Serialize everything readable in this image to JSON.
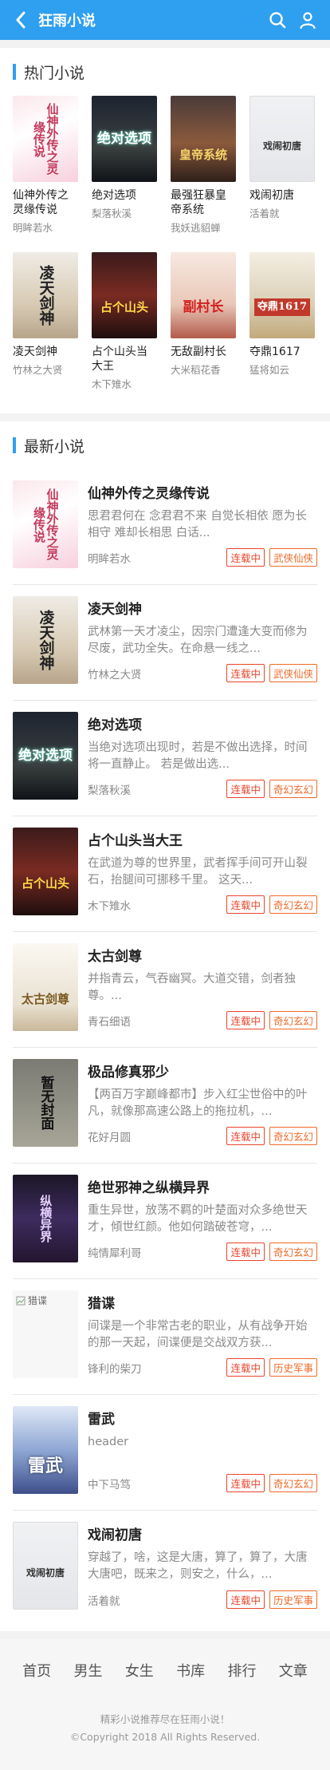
{
  "header": {
    "title": "狂雨小说",
    "back_icon": "back-arrow-icon",
    "search_icon": "search-icon",
    "user_icon": "user-icon"
  },
  "hot": {
    "title": "热门小说",
    "items": [
      {
        "title": "仙神外传之灵缘传说",
        "author": "明眸若水",
        "cover_text": "仙神外传之灵缘传说"
      },
      {
        "title": "绝对选项",
        "author": "梨落秋溪",
        "cover_text": "绝对选项"
      },
      {
        "title": "最强狂暴皇帝系统",
        "author": "我妖逃貂蝉",
        "cover_text": "皇帝系统"
      },
      {
        "title": "戏闹初唐",
        "author": "活着就",
        "cover_text": "戏闹初唐"
      },
      {
        "title": "凌天剑神",
        "author": "竹林之大贤",
        "cover_text": "凌天剑神"
      },
      {
        "title": "占个山头当大王",
        "author": "木下雉水",
        "cover_text": "占个山头"
      },
      {
        "title": "无敌副村长",
        "author": "大米稻花香",
        "cover_text": "副村长"
      },
      {
        "title": "夺鼎1617",
        "author": "猛将如云",
        "cover_text": "夺鼎1617"
      }
    ]
  },
  "latest": {
    "title": "最新小说",
    "items": [
      {
        "title": "仙神外传之灵缘传说",
        "desc": "思君君何在 念君君不来 自觉长相依 愿为长相守 难却长相思 白话...",
        "author": "明眸若水",
        "status": "连载中",
        "genre": "武侠仙侠",
        "cover_text": "仙神外传之灵缘传说"
      },
      {
        "title": "凌天剑神",
        "desc": "武林第一天才凌尘，因宗门遭逢大变而修为尽废，武功全失。在命悬一线之...",
        "author": "竹林之大贤",
        "status": "连载中",
        "genre": "武侠仙侠",
        "cover_text": "凌天剑神"
      },
      {
        "title": "绝对选项",
        "desc": "当绝对选项出现时，若是不做出选择，时间将一直静止。 若是做出选...",
        "author": "梨落秋溪",
        "status": "连载中",
        "genre": "奇幻玄幻",
        "cover_text": "绝对选项"
      },
      {
        "title": "占个山头当大王",
        "desc": "在武道为尊的世界里，武者挥手间可开山裂石，抬腿间可挪移千里。 这天...",
        "author": "木下雉水",
        "status": "连载中",
        "genre": "奇幻玄幻",
        "cover_text": "占个山头"
      },
      {
        "title": "太古剑尊",
        "desc": "并指青云，气吞幽冥。大道交错，剑者独尊。...",
        "author": "青石细语",
        "status": "连载中",
        "genre": "奇幻玄幻",
        "cover_text": "太古剑尊"
      },
      {
        "title": "极品修真邪少",
        "desc": "【两百万字巅峰都市】步入红尘世俗中的叶凡，就像那高速公路上的拖拉机，...",
        "author": "花好月圆",
        "status": "连载中",
        "genre": "奇幻玄幻",
        "cover_text": "暂无封面"
      },
      {
        "title": "绝世邪神之纵横异界",
        "desc": "重生异世，放荡不羁的叶楚面对众多绝世天才，傾世红颜。他如何踏破苍穹，...",
        "author": "纯情犀利哥",
        "status": "连载中",
        "genre": "奇幻玄幻",
        "cover_text": "纵横异界"
      },
      {
        "title": "猎谍",
        "desc": "间谍是一个非常古老的职业，从有战争开始的那一天起，间谍便是交战双方获...",
        "author": "锋利的柴刀",
        "status": "连载中",
        "genre": "历史军事",
        "cover_text": "猎谍"
      },
      {
        "title": "雷武",
        "desc": "header",
        "author": "中下马笃",
        "status": "连载中",
        "genre": "奇幻玄幻",
        "cover_text": "雷武"
      },
      {
        "title": "戏闹初唐",
        "desc": "穿越了，啥，这是大唐，算了，算了，大唐大唐吧，既来之，则安之，什么，...",
        "author": "活着就",
        "status": "连载中",
        "genre": "历史军事",
        "cover_text": "戏闹初唐"
      }
    ]
  },
  "nav": {
    "items": [
      "首页",
      "男生",
      "女生",
      "书库",
      "排行",
      "文章"
    ]
  },
  "footer": {
    "line1": "精彩小说推荐尽在狂雨小说！",
    "line2": "©Copyright 2018 All Rights Reserved."
  }
}
